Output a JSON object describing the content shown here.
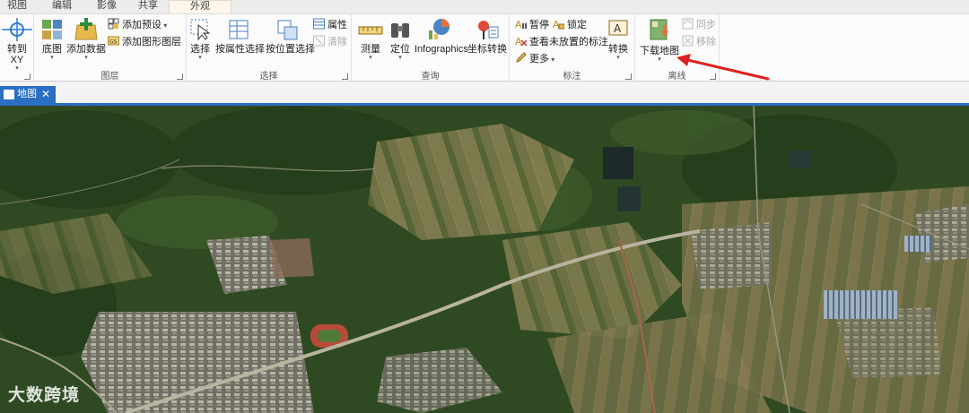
{
  "menu_tabs": [
    "视图",
    "编辑",
    "影像",
    "共享",
    "外观"
  ],
  "ribbon": {
    "groups": {
      "layer": "图层",
      "selection": "选择",
      "query": "查询",
      "labeling": "标注",
      "offline": "离线"
    },
    "goto_xy": {
      "line1": "转到",
      "line2": "XY"
    },
    "basemap": "底图",
    "add_data": "添加数据",
    "add_preset": "添加预设",
    "add_graphics_layer": "添加图形图层",
    "select": "选择",
    "select_by_attributes": "按属性选择",
    "select_by_location": "按位置选择",
    "attributes": "属性",
    "clear": "清除",
    "measure": "测量",
    "locate": "定位",
    "infographics": "Infographics",
    "convert_coordinates": "坐标转换",
    "pause": "暂停",
    "lock": "锁定",
    "view_unplaced": "查看未放置的标注",
    "more": "更多",
    "convert": "转换",
    "download_map": "下载地图",
    "sync": "同步",
    "remove": "移除"
  },
  "document_tab": {
    "label": "地图",
    "close": "✕"
  },
  "watermark": "大数跨境",
  "colors": {
    "accent_blue": "#2b6fc4",
    "arrow_red": "#e02020",
    "ribbon_bg": "#fbfbfb"
  }
}
